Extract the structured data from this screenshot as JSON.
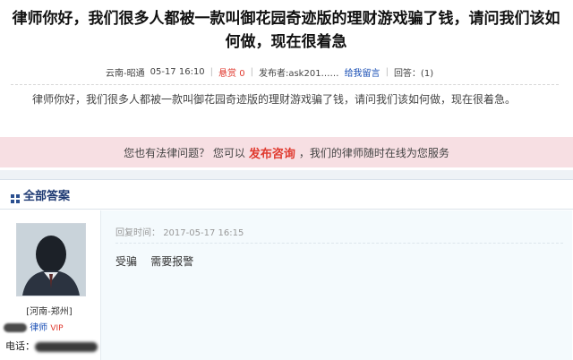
{
  "question": {
    "title": "律师你好，我们很多人都被一款叫御花园奇迹版的理财游戏骗了钱，请问我们该如何做，现在很着急",
    "meta": {
      "location": "云南-昭通",
      "date": "05-17 16:10",
      "reward": "悬赏 0",
      "asker": "发布者:ask201……",
      "message_link": "给我留言",
      "replies": "回答：(1)"
    },
    "body": "律师你好，我们很多人都被一款叫御花园奇迹版的理财游戏骗了钱，请问我们该如何做，现在很着急。"
  },
  "consult_banner": {
    "prefix": "您也有法律问题？ 您可以",
    "publish_link": "发布咨询",
    "suffix": "，我们的律师随时在线为您服务"
  },
  "answers": {
    "header_title": "全部答案",
    "items": [
      {
        "location": "[河南-郑州]",
        "role": "律师",
        "vip": "VIP",
        "phone_label": "电话：",
        "reply_time_label": "回复时间：",
        "reply_time": "2017-05-17 16:15",
        "text": "受骗    需要报警"
      }
    ]
  },
  "colors": {
    "accent_red": "#e03a2f",
    "link_blue": "#1a4fb5",
    "banner_bg": "#f7dfe3",
    "answer_bg": "#f4fafd"
  }
}
